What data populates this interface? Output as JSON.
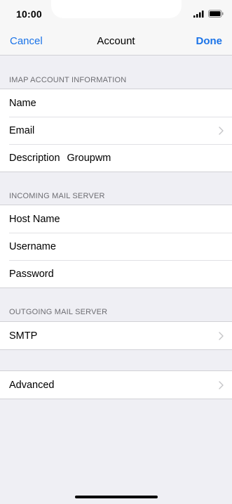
{
  "status_bar": {
    "time": "10:00"
  },
  "nav": {
    "cancel_label": "Cancel",
    "title": "Account",
    "done_label": "Done"
  },
  "sections": {
    "imap": {
      "header": "IMAP ACCOUNT INFORMATION",
      "rows": [
        {
          "label": "Name",
          "value": ""
        },
        {
          "label": "Email",
          "value": ""
        },
        {
          "label": "Description",
          "value": "Groupwm"
        }
      ]
    },
    "incoming": {
      "header": "INCOMING MAIL SERVER",
      "rows": [
        {
          "label": "Host Name",
          "value": ""
        },
        {
          "label": "Username",
          "value": ""
        },
        {
          "label": "Password",
          "value": ""
        }
      ]
    },
    "outgoing": {
      "header": "OUTGOING MAIL SERVER",
      "rows": [
        {
          "label": "SMTP",
          "value": ""
        }
      ]
    },
    "advanced": {
      "rows": [
        {
          "label": "Advanced",
          "value": ""
        }
      ]
    }
  },
  "colors": {
    "accent": "#1a73e8",
    "background": "#efeff4",
    "separator": "#d1d1d6",
    "header_text": "#6d6d72"
  },
  "icons": {
    "signal": "signal-icon",
    "battery": "battery-icon",
    "chevron": "chevron-right-icon"
  }
}
